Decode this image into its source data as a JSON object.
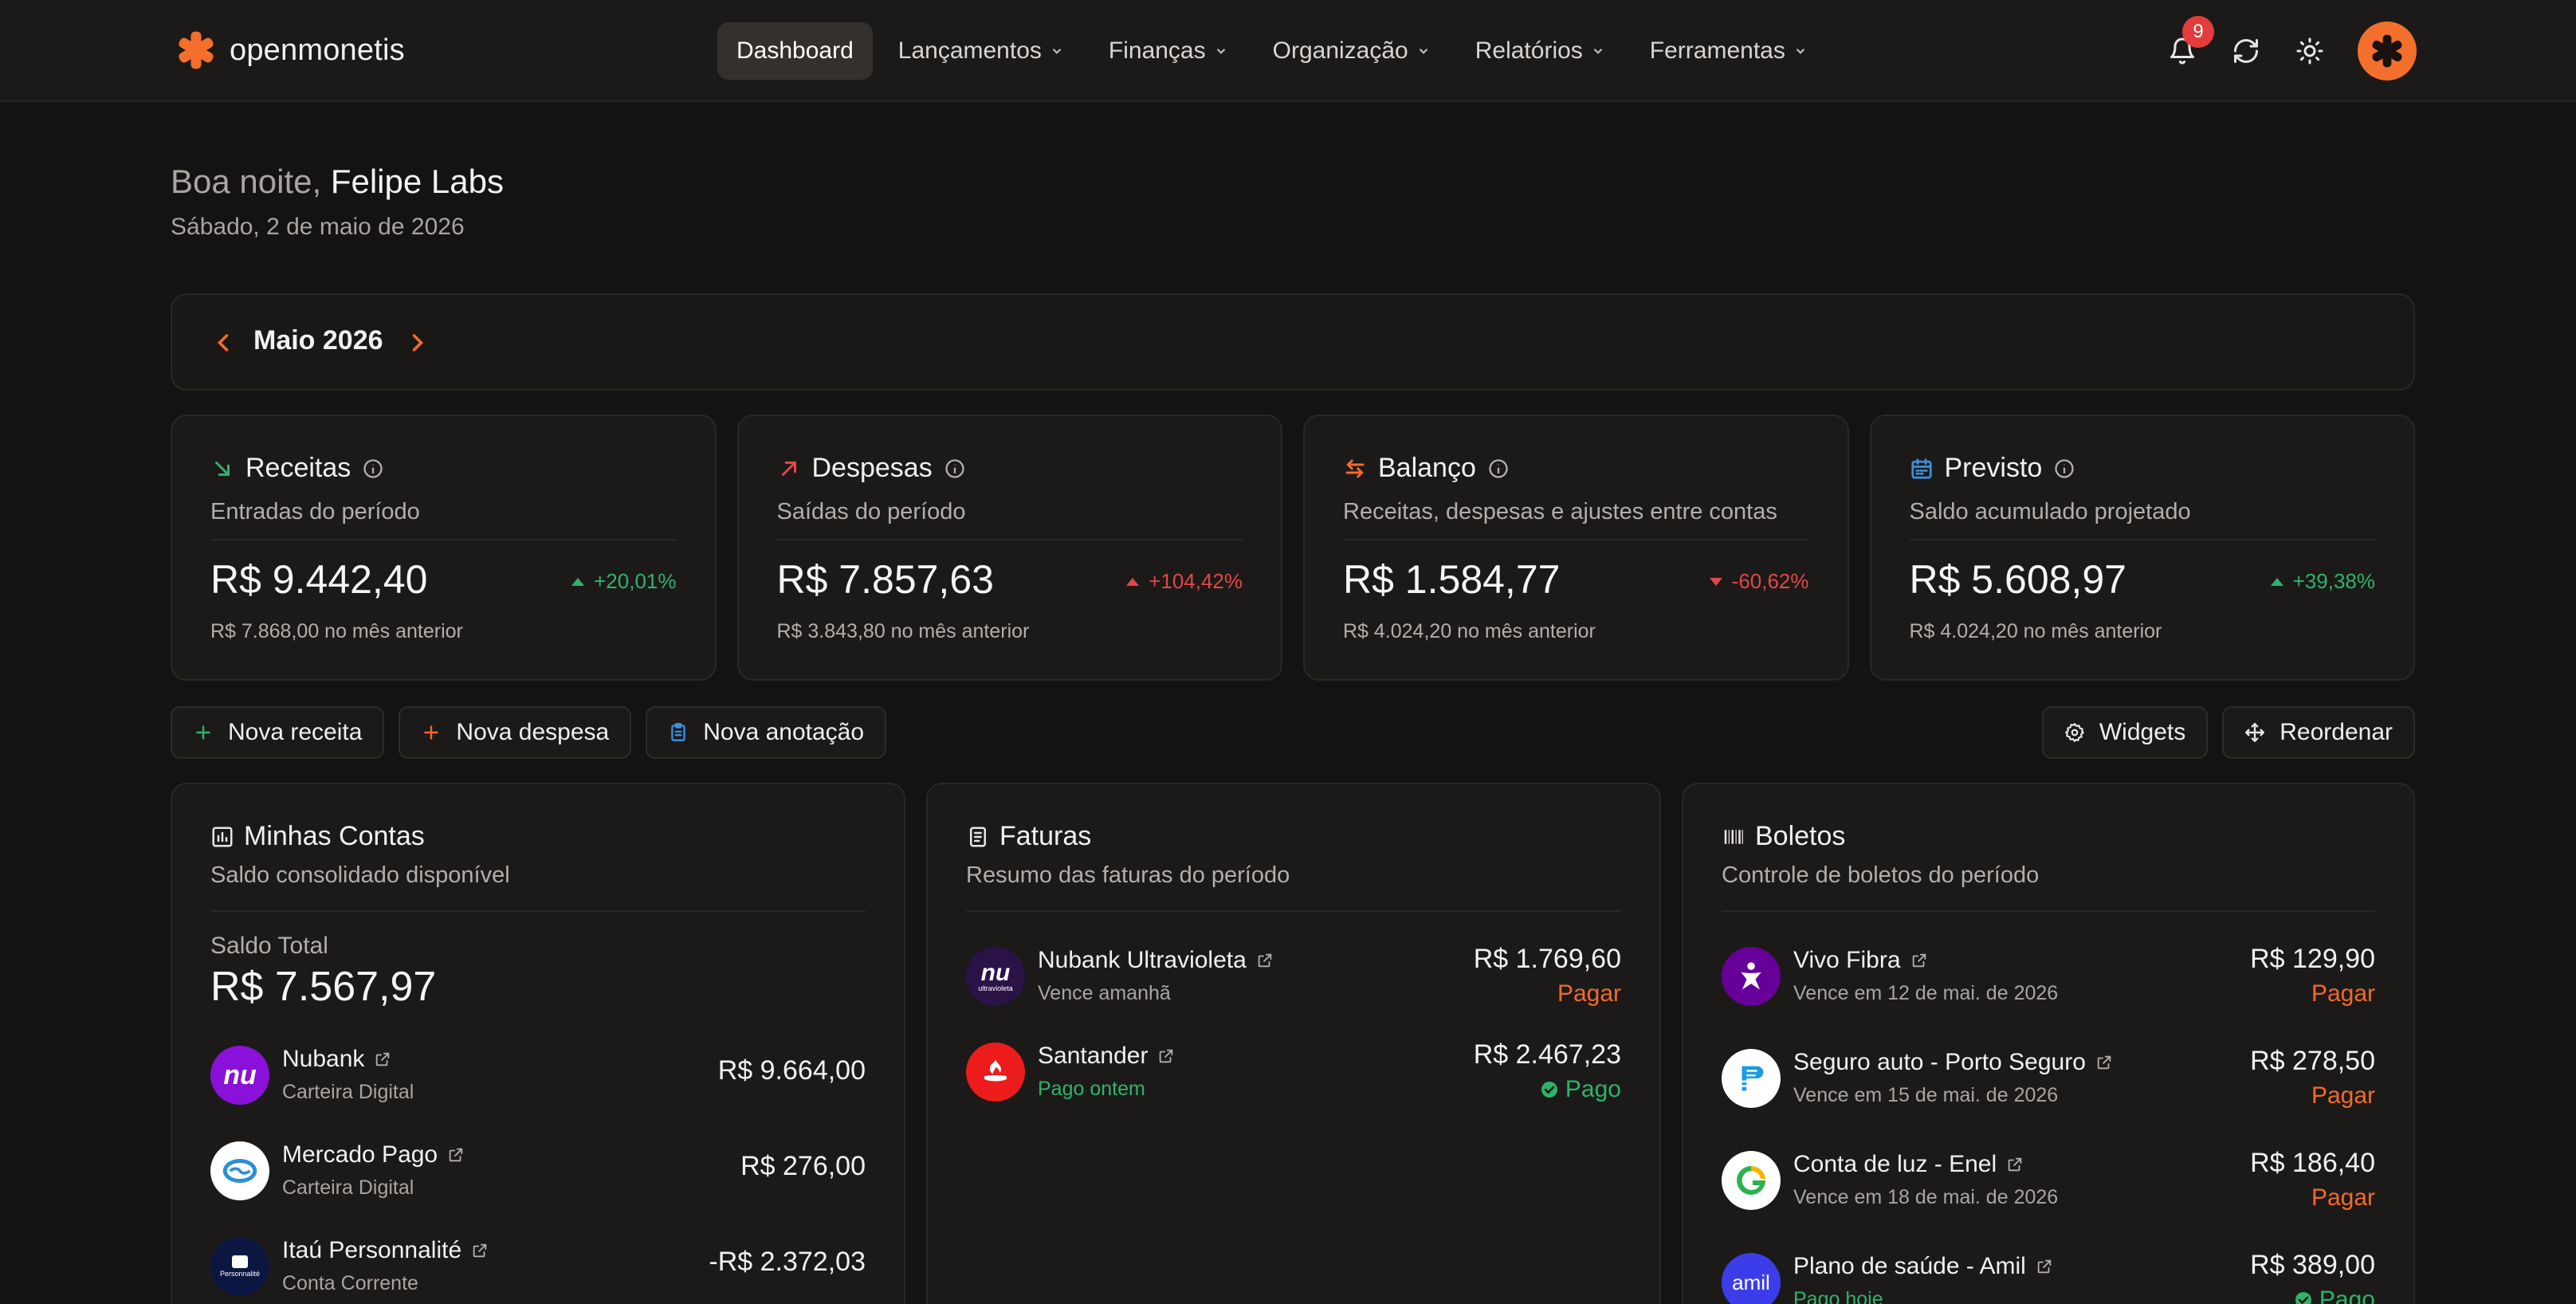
{
  "brand": {
    "name": "openmonetis",
    "color": "#f46f2b"
  },
  "nav": {
    "items": [
      {
        "label": "Dashboard",
        "active": true,
        "dropdown": false
      },
      {
        "label": "Lançamentos",
        "dropdown": true
      },
      {
        "label": "Finanças",
        "dropdown": true
      },
      {
        "label": "Organização",
        "dropdown": true
      },
      {
        "label": "Relatórios",
        "dropdown": true
      },
      {
        "label": "Ferramentas",
        "dropdown": true
      }
    ],
    "notifications_count": "9"
  },
  "greeting": {
    "prefix": "Boa noite,",
    "name": "Felipe Labs",
    "date": "Sábado, 2 de maio de 2026"
  },
  "month": {
    "label": "Maio 2026"
  },
  "stats": [
    {
      "title": "Receitas",
      "subtitle": "Entradas do período",
      "value": "R$ 9.442,40",
      "change": "+20,01%",
      "trend": "up",
      "previous": "R$ 7.868,00 no mês anterior",
      "icon": "arrow-down-right-icon",
      "color": "#2fb36b"
    },
    {
      "title": "Despesas",
      "subtitle": "Saídas do período",
      "value": "R$ 7.857,63",
      "change": "+104,42%",
      "trend": "up-bad",
      "previous": "R$ 3.843,80 no mês anterior",
      "icon": "arrow-up-right-icon",
      "color": "#e04848"
    },
    {
      "title": "Balanço",
      "subtitle": "Receitas, despesas e ajustes entre contas",
      "value": "R$ 1.584,77",
      "change": "-60,62%",
      "trend": "down",
      "previous": "R$ 4.024,20 no mês anterior",
      "icon": "swap-icon",
      "color": "#f26a2b"
    },
    {
      "title": "Previsto",
      "subtitle": "Saldo acumulado projetado",
      "value": "R$ 5.608,97",
      "change": "+39,38%",
      "trend": "up",
      "previous": "R$ 4.024,20 no mês anterior",
      "icon": "calendar-icon",
      "color": "#3b8fe0"
    }
  ],
  "actions": {
    "new_income": "Nova receita",
    "new_expense": "Nova despesa",
    "new_note": "Nova anotação",
    "widgets": "Widgets",
    "reorder": "Reordenar"
  },
  "accounts": {
    "title": "Minhas Contas",
    "subtitle": "Saldo consolidado disponível",
    "total_label": "Saldo Total",
    "total_value": "R$ 7.567,97",
    "items": [
      {
        "name": "Nubank",
        "type": "Carteira Digital",
        "amount": "R$ 9.664,00",
        "logo_text": "nu",
        "logo_color": "#8a11d9"
      },
      {
        "name": "Mercado Pago",
        "type": "Carteira Digital",
        "amount": "R$ 276,00",
        "logo_text": "",
        "logo_color": "#ffffff"
      },
      {
        "name": "Itaú Personnalité",
        "type": "Conta Corrente",
        "amount": "-R$ 2.372,03",
        "logo_text": "Personnalité",
        "logo_color": "#0b1740"
      }
    ]
  },
  "invoices": {
    "title": "Faturas",
    "subtitle": "Resumo das faturas do período",
    "items": [
      {
        "name": "Nubank Ultravioleta",
        "meta": "Vence amanhã",
        "amount": "R$ 1.769,60",
        "status": "Pagar",
        "paid": false,
        "logo_text": "nu",
        "logo_sub": "ultravioleta",
        "logo_color": "#2b1247"
      },
      {
        "name": "Santander",
        "meta": "Pago ontem",
        "amount": "R$ 2.467,23",
        "status": "Pago",
        "paid": true,
        "logo_text": "",
        "logo_color": "#ec1c1c"
      }
    ]
  },
  "bills": {
    "title": "Boletos",
    "subtitle": "Controle de boletos do período",
    "items": [
      {
        "name": "Vivo Fibra",
        "meta": "Vence em 12 de mai. de 2026",
        "amount": "R$ 129,90",
        "status": "Pagar",
        "paid": false,
        "logo_color": "#660099"
      },
      {
        "name": "Seguro auto - Porto Seguro",
        "meta": "Vence em 15 de mai. de 2026",
        "amount": "R$ 278,50",
        "status": "Pagar",
        "paid": false,
        "logo_color": "#ffffff"
      },
      {
        "name": "Conta de luz - Enel",
        "meta": "Vence em 18 de mai. de 2026",
        "amount": "R$ 186,40",
        "status": "Pagar",
        "paid": false,
        "logo_color": "#ffffff"
      },
      {
        "name": "Plano de saúde - Amil",
        "meta": "Pago hoje",
        "amount": "R$ 389,00",
        "status": "Pago",
        "paid": true,
        "logo_text": "amil",
        "logo_color": "#3b3ee8"
      }
    ]
  }
}
